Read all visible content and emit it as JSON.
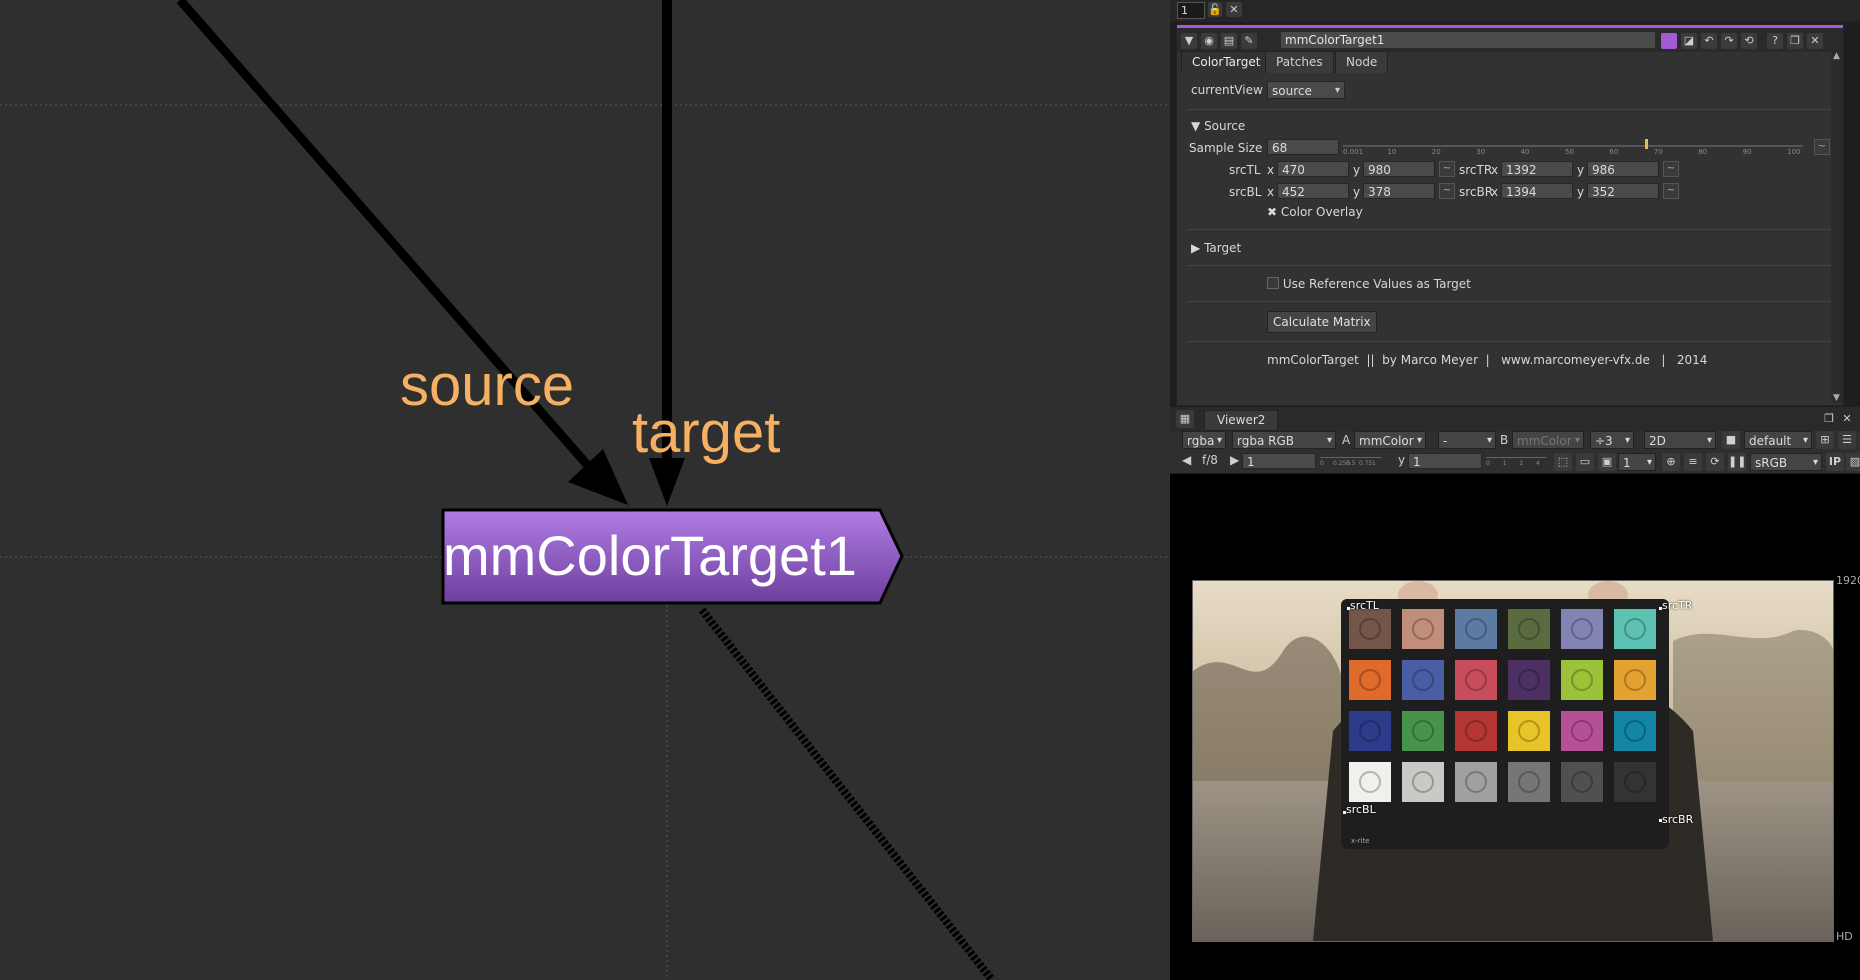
{
  "graph": {
    "node_label": "mmColorTarget1",
    "input_source": "source",
    "input_target": "target"
  },
  "topstrip": {
    "frame": "1",
    "icon_lock": "lock-icon",
    "icon_x": "close-icon",
    "x_label": "X"
  },
  "properties": {
    "node_name": "mmColorTarget1",
    "tabs": [
      {
        "label": "ColorTarget"
      },
      {
        "label": "Patches"
      },
      {
        "label": "Node"
      }
    ],
    "current_view_label": "currentView",
    "current_view_value": "source",
    "source_section": "Source",
    "sample_size_label": "Sample Size",
    "sample_size_value": "68",
    "slider_ticks": [
      "0.001",
      "10",
      "20",
      "30",
      "40",
      "50",
      "60",
      "70",
      "80",
      "90",
      "100"
    ],
    "sample_size_fraction": 0.68,
    "srcTL_label": "srcTL",
    "srcTL_x": "470",
    "srcTL_y": "980",
    "srcTR_label": "srcTR",
    "srcTR_x": "1392",
    "srcTR_y": "986",
    "srcBL_label": "srcBL",
    "srcBL_x": "452",
    "srcBL_y": "378",
    "srcBR_label": "srcBR",
    "srcBR_x": "1394",
    "srcBR_y": "352",
    "x_label": "x",
    "y_label": "y",
    "color_overlay_label": "Color Overlay",
    "color_overlay_checked": true,
    "target_section": "Target",
    "use_reference_label": "Use Reference Values as Target",
    "use_reference_checked": false,
    "calculate_button": "Calculate Matrix",
    "footer": "mmColorTarget  ||  by Marco Meyer  |   www.marcomeyer-vfx.de   |   2014"
  },
  "viewer": {
    "tab_label": "Viewer2",
    "channels": "rgba",
    "channels2": "rgba RGB",
    "a_label": "A",
    "a_input": "mmColor",
    "a_dash": "-",
    "b_label": "B",
    "b_input": "mmColor",
    "zoom": "÷3",
    "mode": "2D",
    "lut": "default",
    "fstop": "f/8",
    "gain": "1",
    "gain_ticks": [
      "0",
      "0.250",
      "0.5",
      "0.75",
      "1"
    ],
    "y_label": "y",
    "gamma": "1",
    "gamma_ticks": [
      "0",
      "1",
      "2",
      "4"
    ],
    "frame": "1",
    "colorspace": "sRGB",
    "ip_label": "IP",
    "format_right": "1920",
    "format_bottom": "HD",
    "corners": {
      "tl": "srcTL",
      "tr": "srcTR",
      "bl": "srcBL",
      "br": "srcBR"
    },
    "chart_brand": "x-rite"
  },
  "colors": {
    "node_purple_top": "#b07de4",
    "node_purple_bottom": "#6e3f9e",
    "label_orange": "#f5b062",
    "accent_purple": "#a45ad8",
    "graph_bg": "#2f2f2f"
  },
  "patches": [
    "#735549",
    "#c18e7c",
    "#5c7ba3",
    "#5a6b3f",
    "#8484b4",
    "#5ec2b2",
    "#e06a2a",
    "#4a5ea8",
    "#c84e5e",
    "#4c3064",
    "#9cc23a",
    "#e4a230",
    "#2c3c8a",
    "#46944a",
    "#b43632",
    "#e8c428",
    "#b65096",
    "#1284a4",
    "#f0f0ec",
    "#c9c9c6",
    "#a0a19f",
    "#767775",
    "#50504f",
    "#333333"
  ]
}
